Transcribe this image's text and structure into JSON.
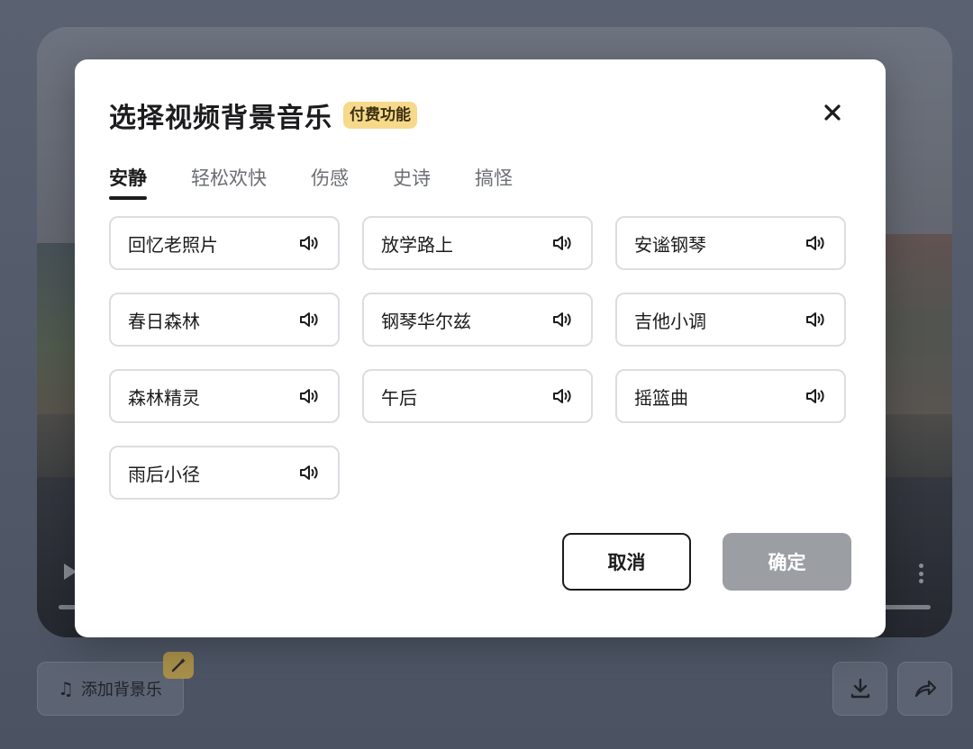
{
  "modal": {
    "title": "选择视频背景音乐",
    "badge": "付费功能",
    "tabs": [
      {
        "label": "安静",
        "active": true
      },
      {
        "label": "轻松欢快",
        "active": false
      },
      {
        "label": "伤感",
        "active": false
      },
      {
        "label": "史诗",
        "active": false
      },
      {
        "label": "搞怪",
        "active": false
      }
    ],
    "tracks": [
      "回忆老照片",
      "放学路上",
      "安谧钢琴",
      "春日森林",
      "钢琴华尔兹",
      "吉他小调",
      "森林精灵",
      "午后",
      "摇篮曲",
      "雨后小径"
    ],
    "cancel_label": "取消",
    "confirm_label": "确定"
  },
  "toolbar": {
    "bgm_label": "添加背景乐"
  },
  "icons": {
    "close": "close-icon",
    "speaker": "speaker-icon",
    "music_note": "music-note-icon",
    "magic": "magic-wand-icon",
    "download": "download-icon",
    "share": "share-icon",
    "play": "play-icon",
    "more": "more-vertical-icon"
  },
  "colors": {
    "badge_bg": "#f6d98a",
    "confirm_disabled": "#9b9ea3",
    "text_primary": "#1c1c1e"
  }
}
